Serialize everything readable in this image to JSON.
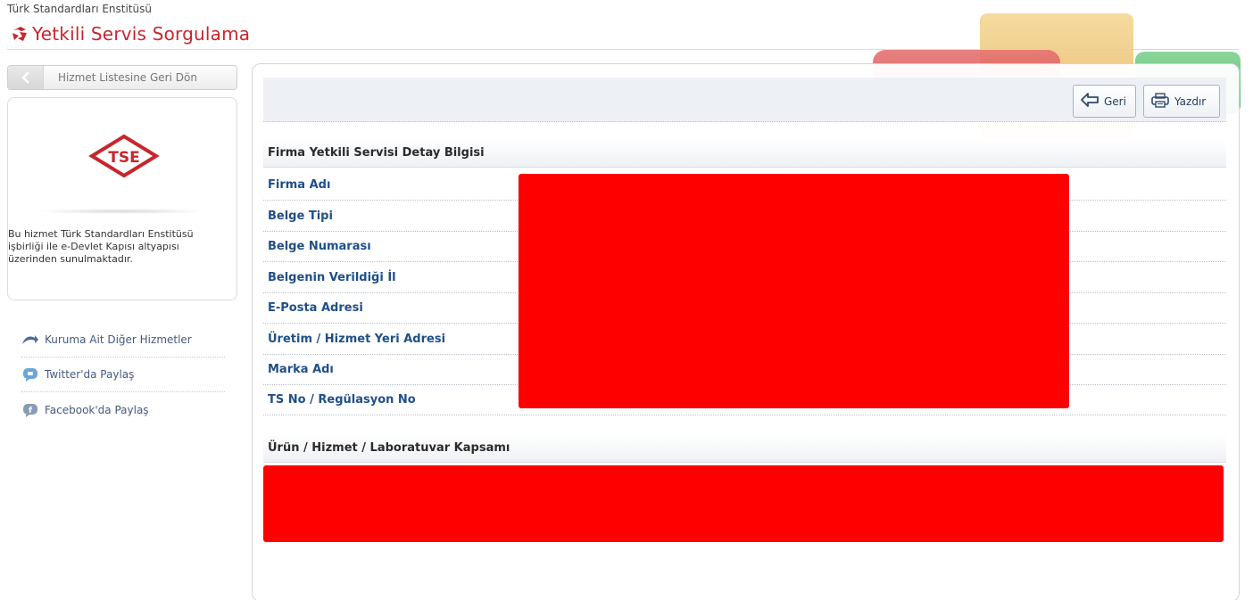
{
  "header": {
    "org_name": "Türk Standardları Enstitüsü",
    "service_title": "Yetkili Servis Sorgulama"
  },
  "sidebar": {
    "back_label": "Hizmet Listesine Geri Dön",
    "info_text": "Bu hizmet Türk Standardları Enstitüsü işbirliği ile e-Devlet Kapısı altyapısı üzerinden sunulmaktadır.",
    "links": [
      {
        "label": "Kuruma Ait Diğer Hizmetler",
        "icon": "other-services-icon"
      },
      {
        "label": "Twitter'da Paylaş",
        "icon": "twitter-icon"
      },
      {
        "label": "Facebook'da Paylaş",
        "icon": "facebook-icon"
      }
    ]
  },
  "toolbar": {
    "back_label": "Geri",
    "print_label": "Yazdır"
  },
  "details": {
    "header": "Firma Yetkili Servisi Detay Bilgisi",
    "fields": [
      "Firma Adı",
      "Belge Tipi",
      "Belge Numarası",
      "Belgenin Verildiği İl",
      "E-Posta Adresi",
      "Üretim / Hizmet Yeri Adresi",
      "Marka Adı",
      "TS No / Regülasyon No"
    ]
  },
  "scope": {
    "header": "Ürün / Hizmet / Laboratuvar Kapsamı"
  },
  "colors": {
    "brand_red": "#c8262c",
    "label_blue": "#1f4f8a",
    "redaction": "#ff0000"
  }
}
